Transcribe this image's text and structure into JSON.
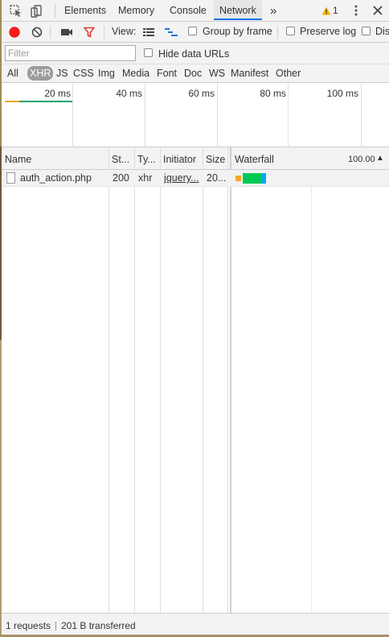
{
  "tabs": [
    {
      "label": "Elements"
    },
    {
      "label": "Memory"
    },
    {
      "label": "Console"
    },
    {
      "label": "Network",
      "active": true
    }
  ],
  "more_tabs": "»",
  "warning_count": "1",
  "toolbar": {
    "view_label": "View:",
    "group_by_frame": "Group by frame",
    "preserve_log": "Preserve log",
    "disable_cache": "Dis"
  },
  "filter": {
    "placeholder": "Filter",
    "hide_data_urls": "Hide data URLs"
  },
  "resource_types": [
    "All",
    "XHR",
    "JS",
    "CSS",
    "Img",
    "Media",
    "Font",
    "Doc",
    "WS",
    "Manifest",
    "Other"
  ],
  "active_type": "XHR",
  "overview": {
    "ticks": [
      "20 ms",
      "40 ms",
      "60 ms",
      "80 ms",
      "100 ms"
    ]
  },
  "table": {
    "columns": [
      "Name",
      "St...",
      "Ty...",
      "Initiator",
      "Size",
      "Waterfall",
      "100.00"
    ],
    "sort_indicator": "▲",
    "rows": [
      {
        "name": "auth_action.php",
        "status": "200",
        "type": "xhr",
        "initiator": "jquery...",
        "size": "20..."
      }
    ]
  },
  "status": {
    "requests": "1 requests",
    "transferred": "201 B transferred"
  },
  "colors": {
    "accent": "#1a73e8",
    "record": "#ff1a1a",
    "filter_icon": "#e53935",
    "waiting": "#f5a623",
    "download": "#00c853",
    "receive": "#03a9f4"
  }
}
